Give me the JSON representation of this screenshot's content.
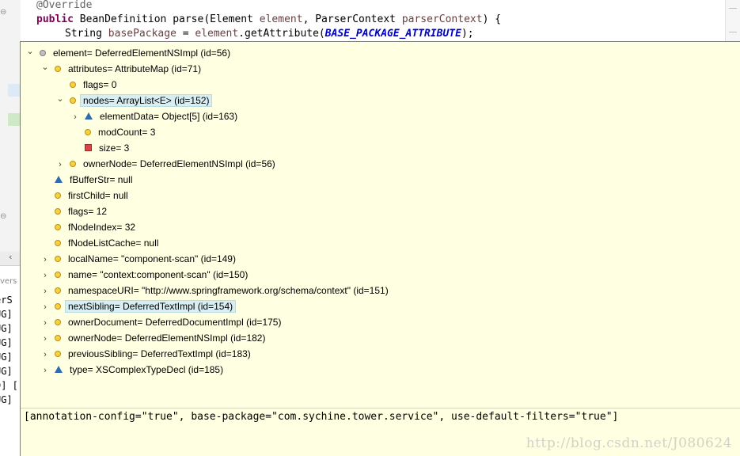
{
  "editor": {
    "lines": {
      "annotation": "@Override",
      "kw_public": "public",
      "method_sig_a": " BeanDefinition parse(Element ",
      "param_element": "element",
      "method_sig_b": ", ParserContext ",
      "param_ctx": "parserContext",
      "method_sig_c": ") {",
      "type_string": "String ",
      "var_base": "basePackage",
      "assign_a": " = ",
      "var_element": "element",
      "call_a": ".getAttribute(",
      "const_name": "BASE_PACKAGE_ATTRIBUTE",
      "call_b": ");"
    }
  },
  "left_panel": {
    "tab_label": "vers",
    "console_lines": [
      "erS",
      "UG]",
      "UG]",
      "UG]",
      "UG]",
      "UG]",
      "D] [",
      "UG]"
    ]
  },
  "inspect": {
    "nodes": [
      {
        "label": "element= DeferredElementNSImpl  (id=56)",
        "expander": "expanded",
        "icon": "gray-circle"
      },
      {
        "label": "attributes= AttributeMap  (id=71)",
        "expander": "expanded",
        "icon": "yellow-circle"
      },
      {
        "label": "flags= 0",
        "expander": "none",
        "icon": "yellow-circle"
      },
      {
        "label": "nodes= ArrayList<E>  (id=152)",
        "expander": "expanded",
        "icon": "yellow-circle"
      },
      {
        "label": "elementData= Object[5]  (id=163)",
        "expander": "collapsed",
        "icon": "blue-triangle"
      },
      {
        "label": "modCount= 3",
        "expander": "none",
        "icon": "yellow-circle"
      },
      {
        "label": "size= 3",
        "expander": "none",
        "icon": "red-square"
      },
      {
        "label": "ownerNode= DeferredElementNSImpl  (id=56)",
        "expander": "collapsed",
        "icon": "yellow-circle"
      },
      {
        "label": "fBufferStr= null",
        "expander": "none",
        "icon": "blue-triangle"
      },
      {
        "label": "firstChild= null",
        "expander": "none",
        "icon": "yellow-circle"
      },
      {
        "label": "flags= 12",
        "expander": "none",
        "icon": "yellow-circle"
      },
      {
        "label": "fNodeIndex= 32",
        "expander": "none",
        "icon": "yellow-circle"
      },
      {
        "label": "fNodeListCache= null",
        "expander": "none",
        "icon": "yellow-circle"
      },
      {
        "label": "localName= \"component-scan\" (id=149)",
        "expander": "collapsed",
        "icon": "yellow-circle"
      },
      {
        "label": "name= \"context:component-scan\" (id=150)",
        "expander": "collapsed",
        "icon": "yellow-circle"
      },
      {
        "label": "namespaceURI= \"http://www.springframework.org/schema/context\" (id=151)",
        "expander": "collapsed",
        "icon": "yellow-circle"
      },
      {
        "label": "nextSibling= DeferredTextImpl  (id=154)",
        "expander": "collapsed",
        "icon": "yellow-circle"
      },
      {
        "label": "ownerDocument= DeferredDocumentImpl  (id=175)",
        "expander": "collapsed",
        "icon": "yellow-circle"
      },
      {
        "label": "ownerNode= DeferredElementNSImpl  (id=182)",
        "expander": "collapsed",
        "icon": "yellow-circle"
      },
      {
        "label": "previousSibling= DeferredTextImpl  (id=183)",
        "expander": "collapsed",
        "icon": "yellow-circle"
      },
      {
        "label": "type= XSComplexTypeDecl  (id=185)",
        "expander": "collapsed",
        "icon": "blue-triangle"
      }
    ],
    "detail_text": "[annotation-config=\"true\", base-package=\"com.sychine.tower.service\", use-default-filters=\"true\"]",
    "watermark": "http://blog.csdn.net/J080624"
  }
}
